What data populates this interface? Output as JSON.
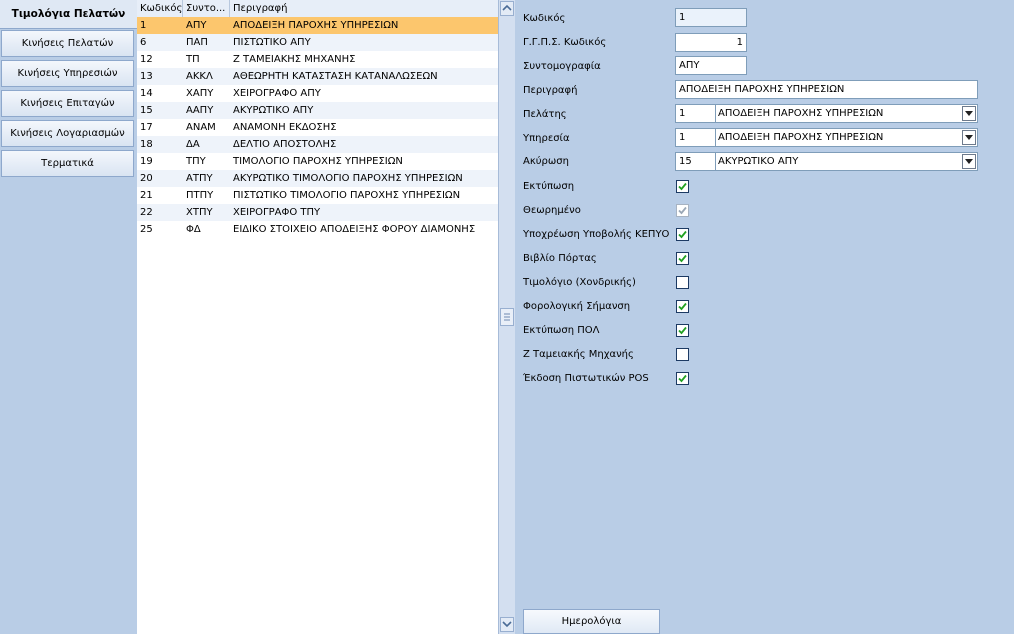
{
  "nav": {
    "title": "Τιμολόγια Πελατών",
    "buttons": [
      "Κινήσεις Πελατών",
      "Κινήσεις Υπηρεσιών",
      "Κινήσεις Επιταγών",
      "Κινήσεις Λογαριασμών",
      "Τερματικά"
    ]
  },
  "grid": {
    "columns": [
      "Κωδικός",
      "Συντο...",
      "Περιγραφή"
    ],
    "rows": [
      {
        "code": "1",
        "abbr": "ΑΠΥ",
        "desc": "ΑΠΟΔΕΙΞΗ ΠΑΡΟΧΗΣ ΥΠΗΡΕΣΙΩΝ"
      },
      {
        "code": "6",
        "abbr": "ΠΑΠ",
        "desc": "ΠΙΣΤΩΤΙΚΟ ΑΠΥ"
      },
      {
        "code": "12",
        "abbr": "ΤΠ",
        "desc": "Ζ ΤΑΜΕΙΑΚΗΣ ΜΗΧΑΝΗΣ"
      },
      {
        "code": "13",
        "abbr": "ΑΚΚΛ",
        "desc": "ΑΘΕΩΡΗΤΗ ΚΑΤΑΣΤΑΣΗ ΚΑΤΑΝΑΛΩΣΕΩΝ"
      },
      {
        "code": "14",
        "abbr": "ΧΑΠΥ",
        "desc": "ΧΕΙΡΟΓΡΑΦΟ ΑΠΥ"
      },
      {
        "code": "15",
        "abbr": "ΑΑΠΥ",
        "desc": "ΑΚΥΡΩΤΙΚΟ ΑΠΥ"
      },
      {
        "code": "17",
        "abbr": "ΑΝΑΜ",
        "desc": "ΑΝΑΜΟΝΗ ΕΚΔΟΣΗΣ"
      },
      {
        "code": "18",
        "abbr": "ΔΑ",
        "desc": "ΔΕΛΤΙΟ ΑΠΟΣΤΟΛΗΣ"
      },
      {
        "code": "19",
        "abbr": "ΤΠΥ",
        "desc": "ΤΙΜΟΛΟΓΙΟ ΠΑΡΟΧΗΣ ΥΠΗΡΕΣΙΩΝ"
      },
      {
        "code": "20",
        "abbr": "ΑΤΠΥ",
        "desc": "ΑΚΥΡΩΤΙΚΟ ΤΙΜΟΛΟΓΙΟ ΠΑΡΟΧΗΣ ΥΠΗΡΕΣΙΩΝ"
      },
      {
        "code": "21",
        "abbr": "ΠΤΠΥ",
        "desc": "ΠΙΣΤΩΤΙΚΟ ΤΙΜΟΛΟΓΙΟ ΠΑΡΟΧΗΣ ΥΠΗΡΕΣΙΩΝ"
      },
      {
        "code": "22",
        "abbr": "ΧΤΠΥ",
        "desc": "ΧΕΙΡΟΓΡΑΦΟ ΤΠΥ"
      },
      {
        "code": "25",
        "abbr": "ΦΔ",
        "desc": "ΕΙΔΙΚΟ ΣΤΟΙΧΕΙΟ ΑΠΟΔΕΙΞΗΣ ΦΟΡΟΥ ΔΙΑΜΟΝΗΣ"
      }
    ]
  },
  "form": {
    "code_label": "Κωδικός",
    "code_value": "1",
    "ggps_label": "Γ.Γ.Π.Σ. Κωδικός",
    "ggps_value": "1",
    "abbr_label": "Συντομογραφία",
    "abbr_value": "ΑΠΥ",
    "desc_label": "Περιγραφή",
    "desc_value": "ΑΠΟΔΕΙΞΗ ΠΑΡΟΧΗΣ ΥΠΗΡΕΣΙΩΝ",
    "customer_label": "Πελάτης",
    "customer_code": "1",
    "customer_text": "ΑΠΟΔΕΙΞΗ ΠΑΡΟΧΗΣ ΥΠΗΡΕΣΙΩΝ",
    "service_label": "Υπηρεσία",
    "service_code": "1",
    "service_text": "ΑΠΟΔΕΙΞΗ ΠΑΡΟΧΗΣ ΥΠΗΡΕΣΙΩΝ",
    "cancel_label": "Ακύρωση",
    "cancel_code": "15",
    "cancel_text": "ΑΚΥΡΩΤΙΚΟ ΑΠΥ",
    "checkboxes": [
      {
        "label": "Εκτύπωση",
        "checked": true,
        "disabled": false
      },
      {
        "label": "Θεωρημένο",
        "checked": true,
        "disabled": true
      },
      {
        "label": "Υποχρέωση Υποβολής ΚΕΠΥΟ",
        "checked": true,
        "disabled": false
      },
      {
        "label": "Βιβλίο Πόρτας",
        "checked": true,
        "disabled": false
      },
      {
        "label": "Τιμολόγιο (Χονδρικής)",
        "checked": false,
        "disabled": false
      },
      {
        "label": "Φορολογική Σήμανση",
        "checked": true,
        "disabled": false
      },
      {
        "label": "Εκτύπωση ΠΟΛ",
        "checked": true,
        "disabled": false
      },
      {
        "label": "Ζ Ταμειακής Μηχανής",
        "checked": false,
        "disabled": false
      },
      {
        "label": "Έκδοση Πιστωτικών POS",
        "checked": true,
        "disabled": false
      }
    ],
    "calendar_button": "Ημερολόγια"
  }
}
